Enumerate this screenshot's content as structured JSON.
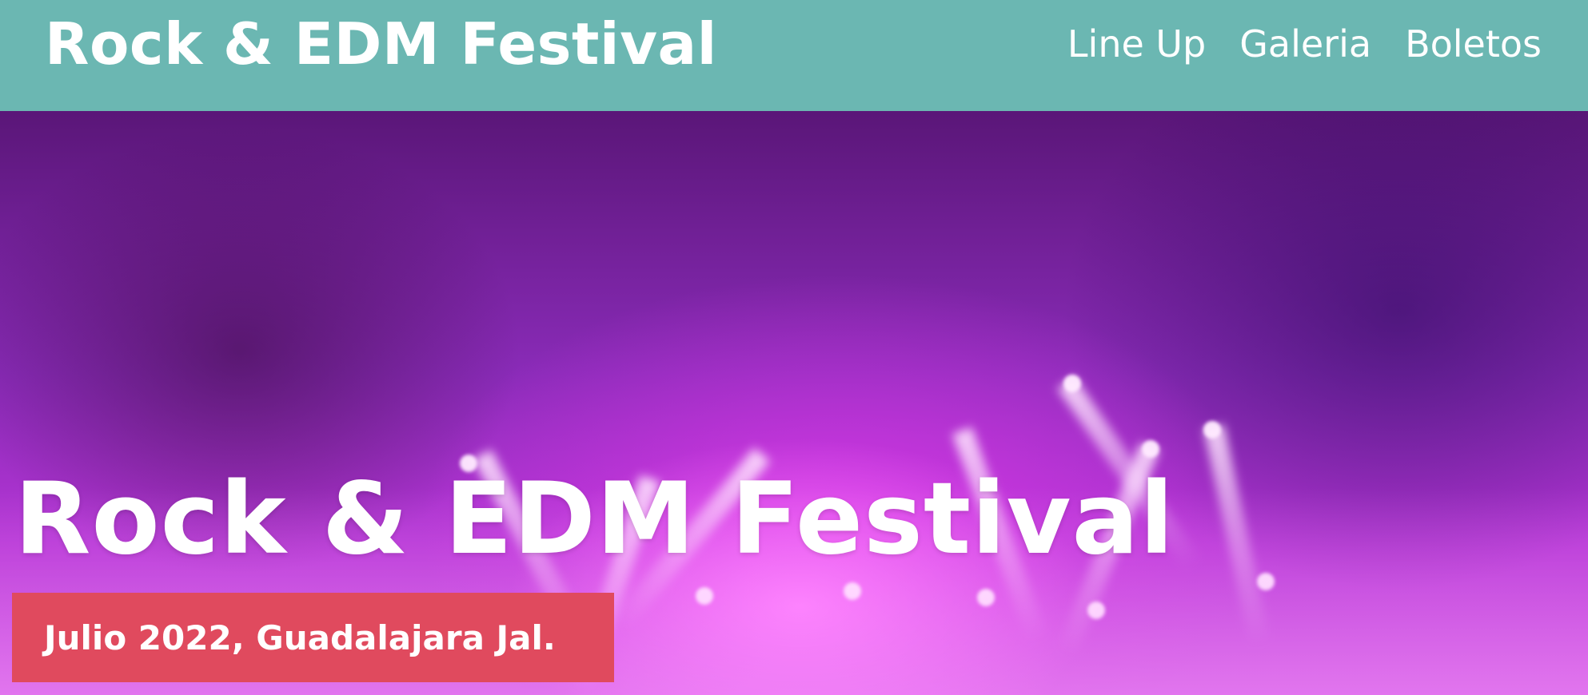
{
  "header": {
    "brand": "Rock & EDM Festival",
    "background_color": "#6bb7b2",
    "nav": [
      {
        "label": "Line Up"
      },
      {
        "label": "Galeria"
      },
      {
        "label": "Boletos"
      }
    ]
  },
  "hero": {
    "title": "Rock & EDM Festival",
    "date_location": "Julio 2022, Guadalajara Jal.",
    "badge_color": "#e04a5e",
    "background_image": "concert-stage-purple-lights"
  }
}
